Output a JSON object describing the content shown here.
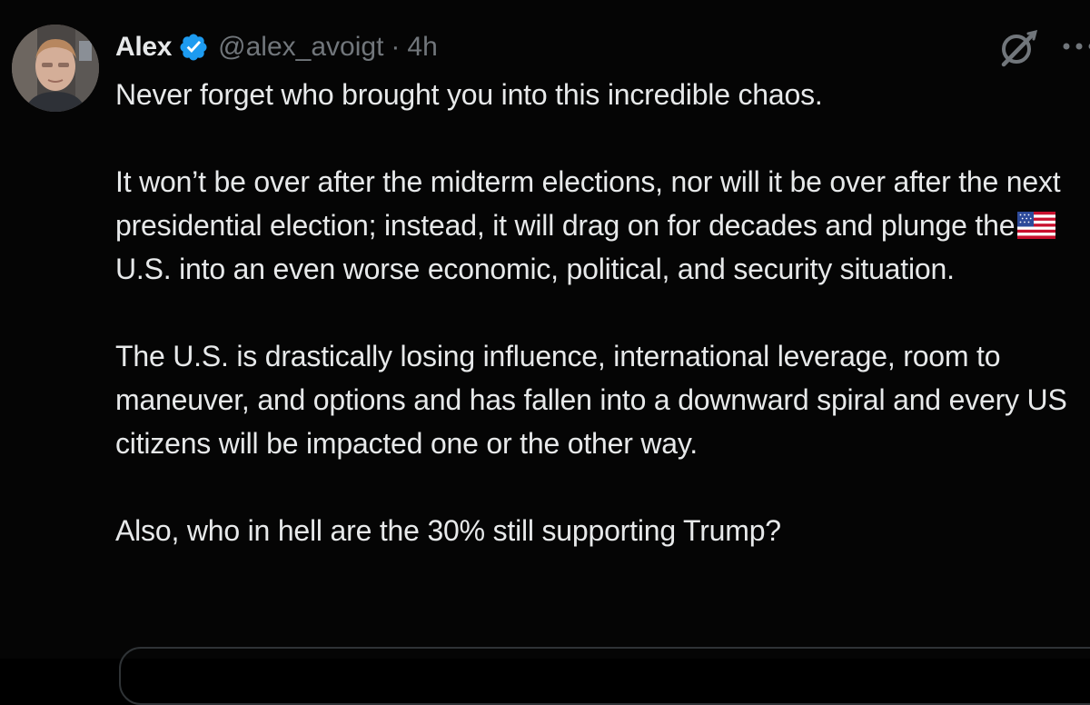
{
  "author": {
    "name": "Alex",
    "handle": "@alex_avoigt",
    "separator": "·",
    "time": "4h"
  },
  "icons": {
    "avatar": "profile-photo",
    "verified": "verified-badge-icon",
    "grok": "grok-icon",
    "more": "more-horizontal-icon",
    "flag": "us-flag-emoji"
  },
  "tweet": {
    "p1": "Never forget who brought you into this incredible chaos.",
    "p2_before_flag": "It won’t be over after the midterm elections, nor will it be over after the next presidential election; instead, it will drag on for decades and plunge the",
    "p2_after_flag": "U.S. into an even worse economic, political, and security situation.",
    "p3": "The U.S. is drastically losing influence, international leverage, room to maneuver, and options and has fallen into a downward spiral and every US citizens will be impacted one or the other way.",
    "p4": "Also, who in hell are the 30% still supporting Trump?"
  },
  "colors": {
    "background": "#050505",
    "text": "#e7e9ea",
    "muted": "#71767b",
    "verified": "#1d9bf0",
    "border": "#2f3336"
  }
}
